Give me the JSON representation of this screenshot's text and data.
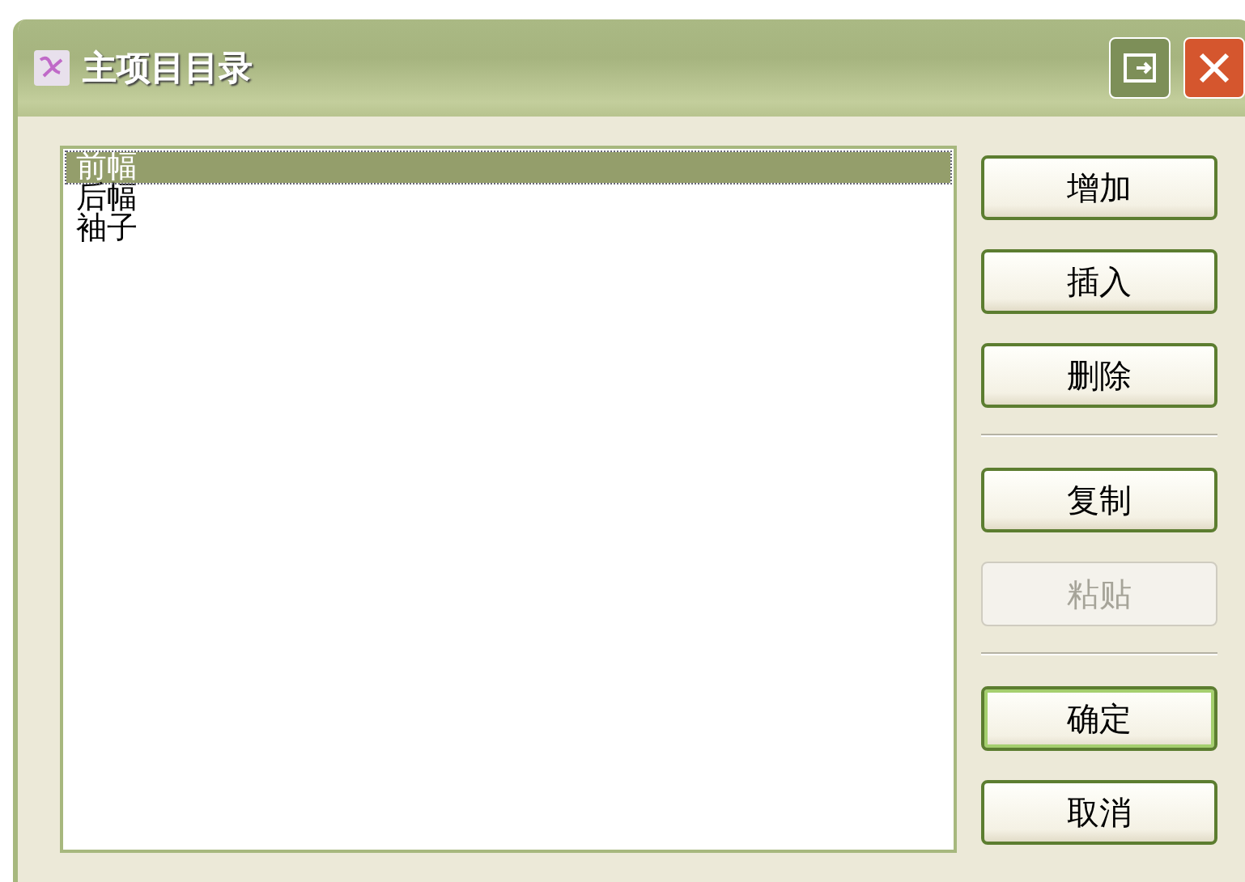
{
  "window": {
    "title": "主项目目录"
  },
  "list": {
    "items": [
      {
        "label": "前幅",
        "selected": true
      },
      {
        "label": "后幅",
        "selected": false
      },
      {
        "label": "袖子",
        "selected": false
      }
    ]
  },
  "button_groups": [
    [
      {
        "label": "增加",
        "disabled": false,
        "default": false
      },
      {
        "label": "插入",
        "disabled": false,
        "default": false
      },
      {
        "label": "删除",
        "disabled": false,
        "default": false
      }
    ],
    [
      {
        "label": "复制",
        "disabled": false,
        "default": false
      },
      {
        "label": "粘贴",
        "disabled": true,
        "default": false
      }
    ],
    [
      {
        "label": "确定",
        "disabled": false,
        "default": true
      },
      {
        "label": "取消",
        "disabled": false,
        "default": false
      }
    ]
  ]
}
